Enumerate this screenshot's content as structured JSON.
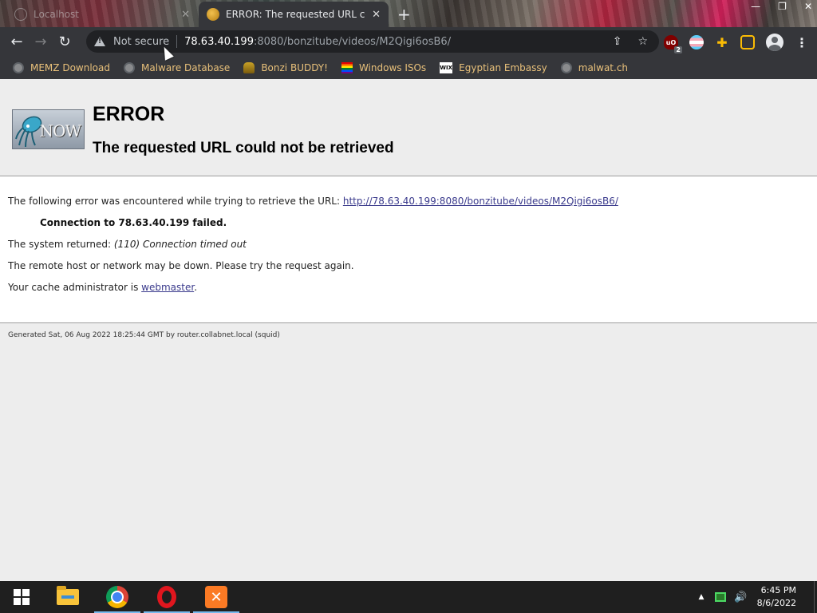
{
  "tabs": [
    {
      "label": "Localhost",
      "active": false
    },
    {
      "label": "ERROR: The requested URL could not be retrieved",
      "active": true
    }
  ],
  "new_tab_symbol": "+",
  "window_controls": {
    "minimize": "—",
    "maximize": "❐",
    "close": "✕"
  },
  "toolbar": {
    "back": "←",
    "forward": "→",
    "reload": "↻",
    "security_label": "Not secure",
    "url_host": "78.63.40.199",
    "url_rest": ":8080/bonzitube/videos/M2Qigi6osB6/",
    "ublock_badge": "2"
  },
  "bookmarks": [
    {
      "label": "MEMZ Download",
      "icon": "globe-icon"
    },
    {
      "label": "Malware Database",
      "icon": "globe-icon"
    },
    {
      "label": "Bonzi BUDDY!",
      "icon": "bonzi-icon"
    },
    {
      "label": "Windows ISOs",
      "icon": "rainbow-flag-icon"
    },
    {
      "label": "Egyptian Embassy",
      "icon": "wix-icon"
    },
    {
      "label": "malwat.ch",
      "icon": "globe-icon"
    }
  ],
  "page": {
    "logo_text": "NOW",
    "title": "ERROR",
    "subtitle": "The requested URL could not be retrieved",
    "error_intro": "The following error was encountered while trying to retrieve the URL: ",
    "error_url": "http://78.63.40.199:8080/bonzitube/videos/M2Qigi6osB6/",
    "connection_failed": "Connection to 78.63.40.199 failed.",
    "system_returned_label": "The system returned: ",
    "system_returned_value": "(110) Connection timed out",
    "remote_down": "The remote host or network may be down. Please try the request again.",
    "cache_admin_prefix": "Your cache administrator is ",
    "cache_admin_link": "webmaster",
    "cache_admin_suffix": ".",
    "footer": "Generated Sat, 06 Aug 2022 18:25:44 GMT by router.collabnet.local (squid)"
  },
  "taskbar": {
    "apps": [
      "file-explorer-icon",
      "chrome-icon",
      "opera-icon",
      "xampp-icon"
    ],
    "xampp_glyph": "✕",
    "tray_up": "▲",
    "volume_glyph": "🔊",
    "time": "6:45 PM",
    "date": "8/6/2022"
  },
  "colors": {
    "chrome_toolbar": "#35363a",
    "bookmark_text": "#e8c07a",
    "page_bg": "#ededed",
    "link": "#3a3a8c",
    "taskbar": "#1f1f1f"
  }
}
